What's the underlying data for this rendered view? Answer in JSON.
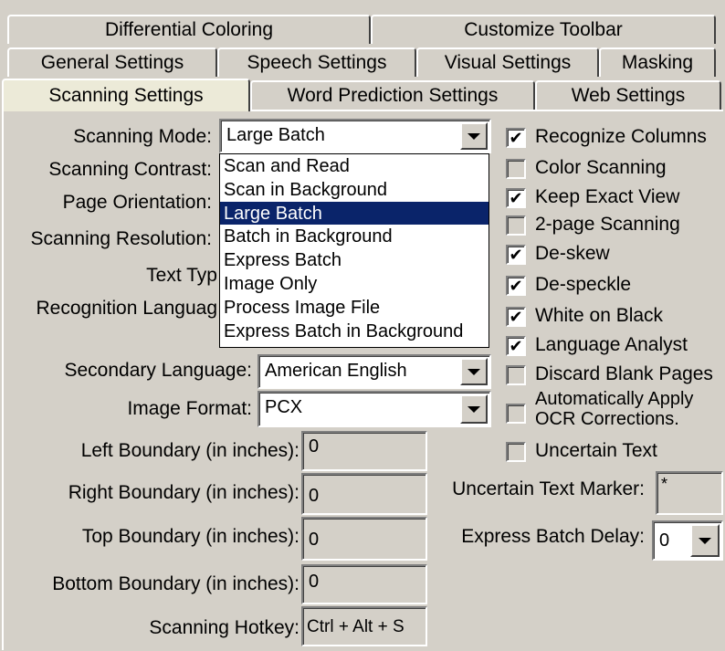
{
  "tabs": {
    "row1": [
      "Differential Coloring",
      "Customize Toolbar"
    ],
    "row2": [
      "General Settings",
      "Speech Settings",
      "Visual Settings",
      "Masking"
    ],
    "row3": [
      "Scanning Settings",
      "Word Prediction Settings",
      "Web Settings"
    ],
    "active": "Scanning Settings"
  },
  "labels": {
    "scanning_mode": "Scanning Mode:",
    "scanning_contrast": "Scanning Contrast:",
    "page_orientation": "Page Orientation:",
    "scanning_resolution": "Scanning Resolution:",
    "text_type": "Text Typ",
    "recognition_language": "Recognition Languag",
    "secondary_language": "Secondary Language:",
    "image_format": "Image Format:",
    "left_boundary": "Left Boundary (in inches):",
    "right_boundary": "Right Boundary (in inches):",
    "top_boundary": "Top Boundary (in inches):",
    "bottom_boundary": "Bottom Boundary (in inches):",
    "scanning_hotkey": "Scanning Hotkey:",
    "uncertain_text_marker": "Uncertain Text Marker:",
    "express_batch_delay": "Express Batch Delay:"
  },
  "fields": {
    "scanning_mode": "Large Batch",
    "secondary_language": "American English",
    "image_format": "PCX",
    "left_boundary": "0",
    "right_boundary": "0",
    "top_boundary": "0",
    "bottom_boundary": "0",
    "scanning_hotkey": "Ctrl + Alt + S",
    "uncertain_text_marker": "*",
    "express_batch_delay": "0"
  },
  "scanning_mode_options": [
    "Scan and Read",
    "Scan in Background",
    "Large Batch",
    "Batch in Background",
    "Express Batch",
    "Image Only",
    "Process Image File",
    "Express Batch in Background"
  ],
  "checkboxes": [
    {
      "label": "Recognize Columns",
      "checked": true
    },
    {
      "label": "Color Scanning",
      "checked": false
    },
    {
      "label": "Keep Exact View",
      "checked": true
    },
    {
      "label": "2-page Scanning",
      "checked": false
    },
    {
      "label": "De-skew",
      "checked": true
    },
    {
      "label": "De-speckle",
      "checked": true
    },
    {
      "label": "White on Black",
      "checked": true
    },
    {
      "label": "Language Analyst",
      "checked": true
    },
    {
      "label": "Discard Blank Pages",
      "checked": false
    },
    {
      "label": "Automatically Apply",
      "label2": "OCR Corrections.",
      "checked": false
    },
    {
      "label": "Uncertain Text",
      "checked": false
    }
  ],
  "check_mark": "✔"
}
